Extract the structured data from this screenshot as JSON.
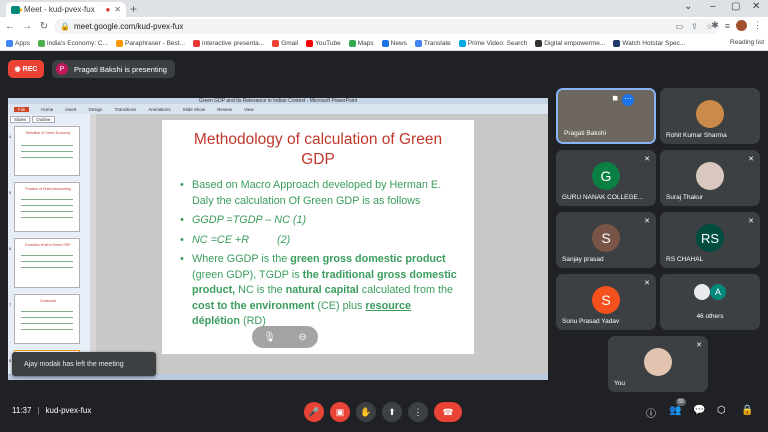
{
  "browser": {
    "tab_title": "Meet - kud-pvex-fux",
    "url": "meet.google.com/kud-pvex-fux",
    "bookmarks": [
      {
        "label": "Apps",
        "color": "#4285f4"
      },
      {
        "label": "India's Economy: C...",
        "color": "#4caf50"
      },
      {
        "label": "Paraphraser - Best...",
        "color": "#ff9800"
      },
      {
        "label": "interactive presenta...",
        "color": "#e53935"
      },
      {
        "label": "Gmail",
        "color": "#ea4335"
      },
      {
        "label": "YouTube",
        "color": "#ff0000"
      },
      {
        "label": "Maps",
        "color": "#34a853"
      },
      {
        "label": "News",
        "color": "#1a73e8"
      },
      {
        "label": "Translate",
        "color": "#4285f4"
      },
      {
        "label": "Prime Video: Search",
        "color": "#00a8e1"
      },
      {
        "label": "Digital empowerme...",
        "color": "#333333"
      },
      {
        "label": "Watch Hotstar Spec...",
        "color": "#1f3a68"
      }
    ],
    "reading_list": "Reading list"
  },
  "meeting": {
    "rec_label": "REC",
    "presenter_initial": "P",
    "presenter_text": "Pragati Bakshi is presenting",
    "time": "11:37",
    "code": "kud-pvex-fux",
    "participant_count": "55",
    "toast": "Ajay modak has left the meeting"
  },
  "ppt": {
    "window_title": "Green GDP and Its Relevance in Indian Context - Microsoft PowerPoint",
    "file_tab": "File",
    "ribbon": [
      "Home",
      "Insert",
      "Design",
      "Transitions",
      "Animations",
      "Slide Show",
      "Review",
      "View"
    ],
    "side_tabs": [
      "Slides",
      "Outline"
    ],
    "thumbnails": [
      {
        "num": "4",
        "title": "Definition of Green Economy"
      },
      {
        "num": "5",
        "title": "Practice of Green Accounting"
      },
      {
        "num": "6",
        "title": "Evolution of term Green GDP"
      },
      {
        "num": "7",
        "title": "Continued"
      },
      {
        "num": "8",
        "title": "Methodology of calculation of Green"
      }
    ]
  },
  "slide": {
    "title": "Methodology  of calculation of Green GDP",
    "bullet1": "Based on Macro Approach developed by Herman E. Daly  the calculation Of Green GDP is as follows",
    "eq1": "GGDP =TGDP – NC   (1)",
    "eq2_a": "NC =CE +R",
    "eq2_b": "(2)",
    "b3_p1": "Where GGDP is the ",
    "b3_p2": "green gross domestic product",
    "b3_p3": " (green GDP), TGDP is ",
    "b3_p4": "the traditional gross domestic product,",
    "b3_p5": " NC is the ",
    "b3_p6": "natural capital",
    "b3_p7": " calculated from the ",
    "b3_p8": "cost to the environment",
    "b3_p9": " (CE) plus ",
    "b3_p10": "resource",
    "b3_p11": "  déplétion",
    "b3_p12": " (RD)"
  },
  "tiles": [
    {
      "name": "Pragati Bakshi"
    },
    {
      "name": "Rohit Kumar Sharma"
    },
    {
      "name": "GURU NANAK COLLEGE...",
      "initial": "G",
      "color": "#0b8043"
    },
    {
      "name": "Suraj Thakur"
    },
    {
      "name": "Sanjay prasad",
      "initial": "S",
      "color": "#795548"
    },
    {
      "name": "RS CHAHAL",
      "initial": "RS",
      "color": "#004d40"
    },
    {
      "name": "Sonu Prasad Yadav",
      "initial": "S",
      "color": "#f4511e"
    },
    {
      "name": "46 others",
      "initial": "A",
      "color": "#00897b"
    },
    {
      "name": "You"
    }
  ]
}
